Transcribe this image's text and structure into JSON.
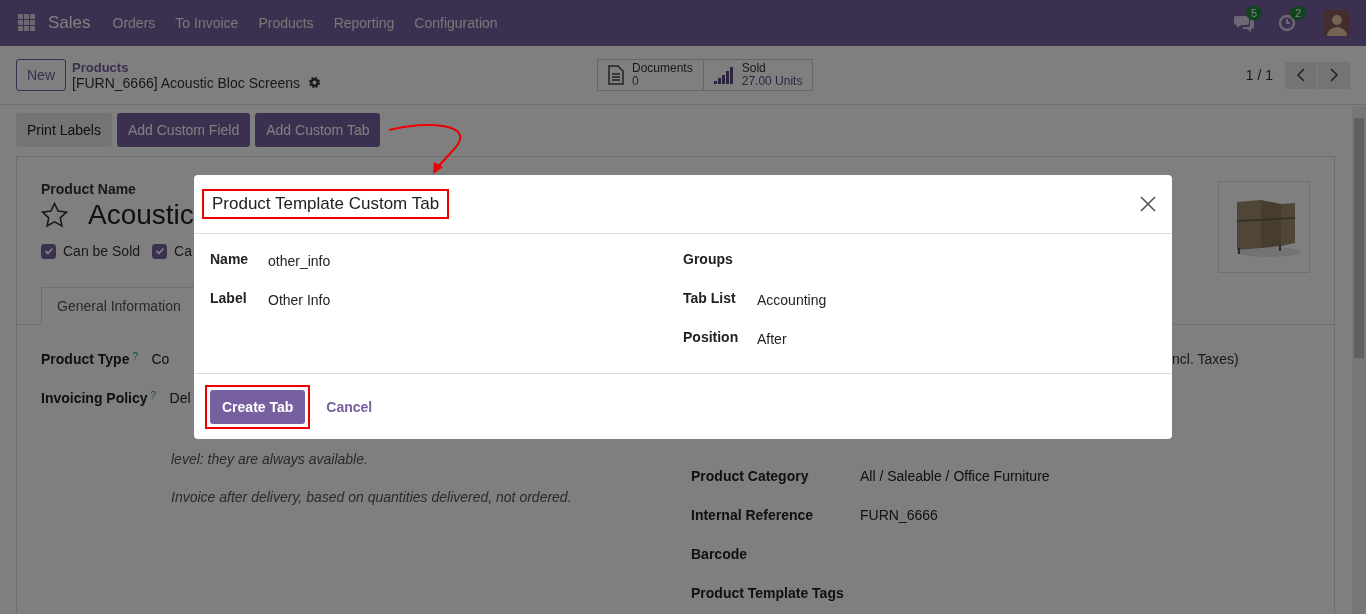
{
  "navbar": {
    "app_name": "Sales",
    "menu": [
      "Orders",
      "To Invoice",
      "Products",
      "Reporting",
      "Configuration"
    ],
    "messages_badge": "5",
    "activities_badge": "2"
  },
  "control_panel": {
    "new_button": "New",
    "breadcrumb_parent": "Products",
    "record_title": "[FURN_6666] Acoustic Bloc Screens",
    "smart_buttons": [
      {
        "kind": "documents",
        "label": "Documents",
        "value": "0"
      },
      {
        "kind": "sold",
        "label": "Sold",
        "value": "27.00 Units"
      }
    ],
    "pager": "1 / 1"
  },
  "action_buttons": [
    {
      "label": "Print Labels",
      "kind": "secondary"
    },
    {
      "label": "Add Custom Field",
      "kind": "primary"
    },
    {
      "label": "Add Custom Tab",
      "kind": "primary"
    }
  ],
  "form": {
    "product_name_label": "Product Name",
    "favorite": false,
    "product_name": "Acoustic",
    "checkboxes": [
      {
        "label": "Can be Sold",
        "checked": true
      },
      {
        "label": "Ca",
        "checked": true
      }
    ],
    "tabs": [
      {
        "label": "General Information",
        "selected": true
      }
    ],
    "left_fields": [
      {
        "label": "Product Type",
        "help": "?",
        "value": "Co"
      },
      {
        "label": "Invoicing Policy",
        "help": "?",
        "value": "Del"
      }
    ],
    "notes": [
      "level: they are always available.",
      "Invoice after delivery, based on quantities delivered, not ordered."
    ],
    "price_suffix": "ncl. Taxes)",
    "right_fields": [
      {
        "label": "Product Category",
        "value": "All / Saleable / Office Furniture"
      },
      {
        "label": "Internal Reference",
        "value": "FURN_6666"
      },
      {
        "label": "Barcode"
      },
      {
        "label": "Product Template Tags"
      }
    ]
  },
  "dialog": {
    "title": "Product Template Custom Tab",
    "left_fields": [
      {
        "label": "Name",
        "value": "other_info"
      },
      {
        "label": "Label",
        "value": "Other Info"
      }
    ],
    "right_fields": [
      {
        "label": "Groups"
      },
      {
        "label": "Tab List",
        "value": "Accounting"
      },
      {
        "label": "Position",
        "value": "After"
      }
    ],
    "buttons": [
      {
        "label": "Create Tab",
        "kind": "primary",
        "highlighted": true
      },
      {
        "label": "Cancel",
        "kind": "link",
        "highlighted": false
      }
    ]
  }
}
